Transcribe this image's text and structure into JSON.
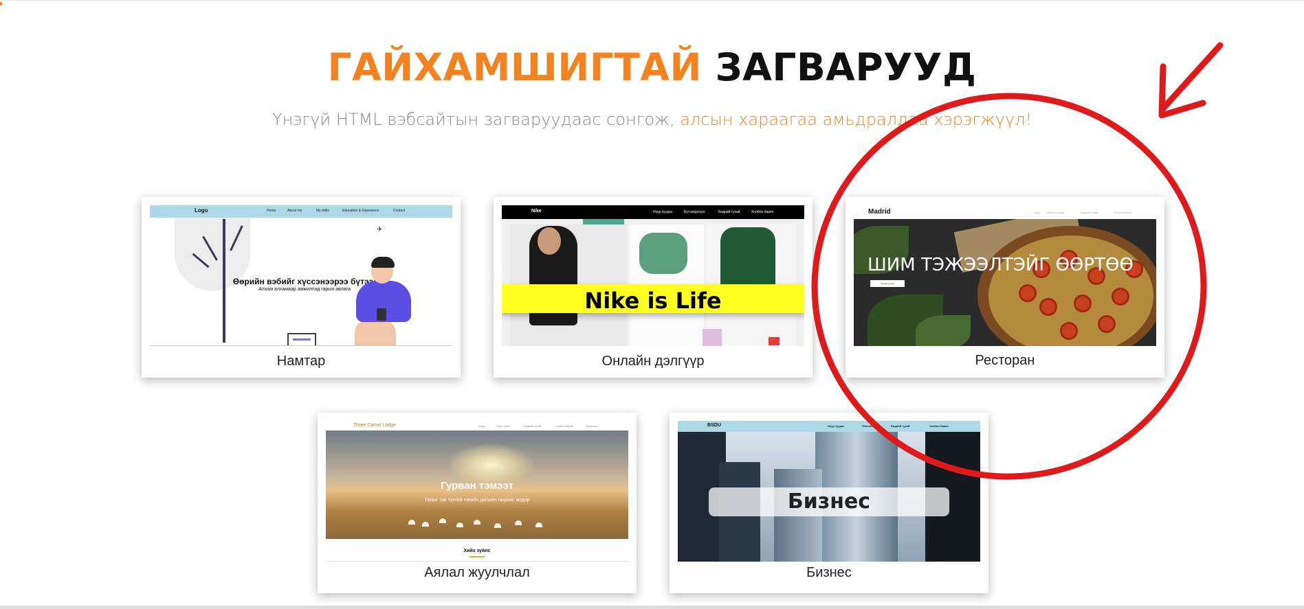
{
  "header": {
    "title_accent": "ГАЙХАМШИГТАЙ",
    "title_rest": "ЗАГВАРУУД",
    "subtitle_plain": "Үнэгүй HTML вэбсайтын загваруудаас сонгож,",
    "subtitle_accent": "алсын хараагаа амьдралдаа хэрэгжүүл!"
  },
  "templates": [
    {
      "caption": "Намтар",
      "preview": {
        "logo": "Logo",
        "nav": [
          "Home",
          "About me",
          "My skills",
          "Education & Experience",
          "Contact"
        ],
        "headline": "Өөрийн вэбийг хүссэнээрээ бүтээ!",
        "tagline": "Алхам алхамаар амжилтад гарын авлага"
      }
    },
    {
      "caption": "Онлайн дэлгүүр",
      "preview": {
        "logo": "Nike",
        "nav": [
          "Нүүр хуудас",
          "Бүтээгдэхүүн",
          "Бидний тухай",
          "Холбоо барих"
        ],
        "banner": "Nike is Life"
      }
    },
    {
      "caption": "Ресторан",
      "preview": {
        "brand": "Madrid",
        "nav": [
          "Нүүр",
          "Захиалга авах",
          "Бидний тухай",
          "Холбоо барих"
        ],
        "headline": "ШИМ ТЭЖЭЭЛТЭЙГ ӨӨРТӨӨ",
        "button": "Захиалга өгөх"
      }
    },
    {
      "caption": "Аялал жуулчлал",
      "preview": {
        "brand": "Three Camel Lodge",
        "nav": [
          "Нүүр",
          "Хийх зүйлс",
          "Бидний тухай",
          "Холбоо барих",
          "Захиалах"
        ],
        "headline": "Гурван тэмээт",
        "tagline": "Таныг тав тухтай говийн дагшин газраас мэдэр",
        "section": "Хийх зүйлс"
      }
    },
    {
      "caption": "Бизнес",
      "preview": {
        "logo": "BSDU",
        "nav": [
          "Нүүр хуудас",
          "Үйлчилгээ",
          "Бидний тухай",
          "Холбоо барих"
        ],
        "headline": "Бизнес"
      }
    }
  ],
  "colors": {
    "accent": "#f4821f",
    "annotation": "#e0191b"
  },
  "annotation": {
    "shapes": [
      "red-circle",
      "red-arrow"
    ]
  }
}
